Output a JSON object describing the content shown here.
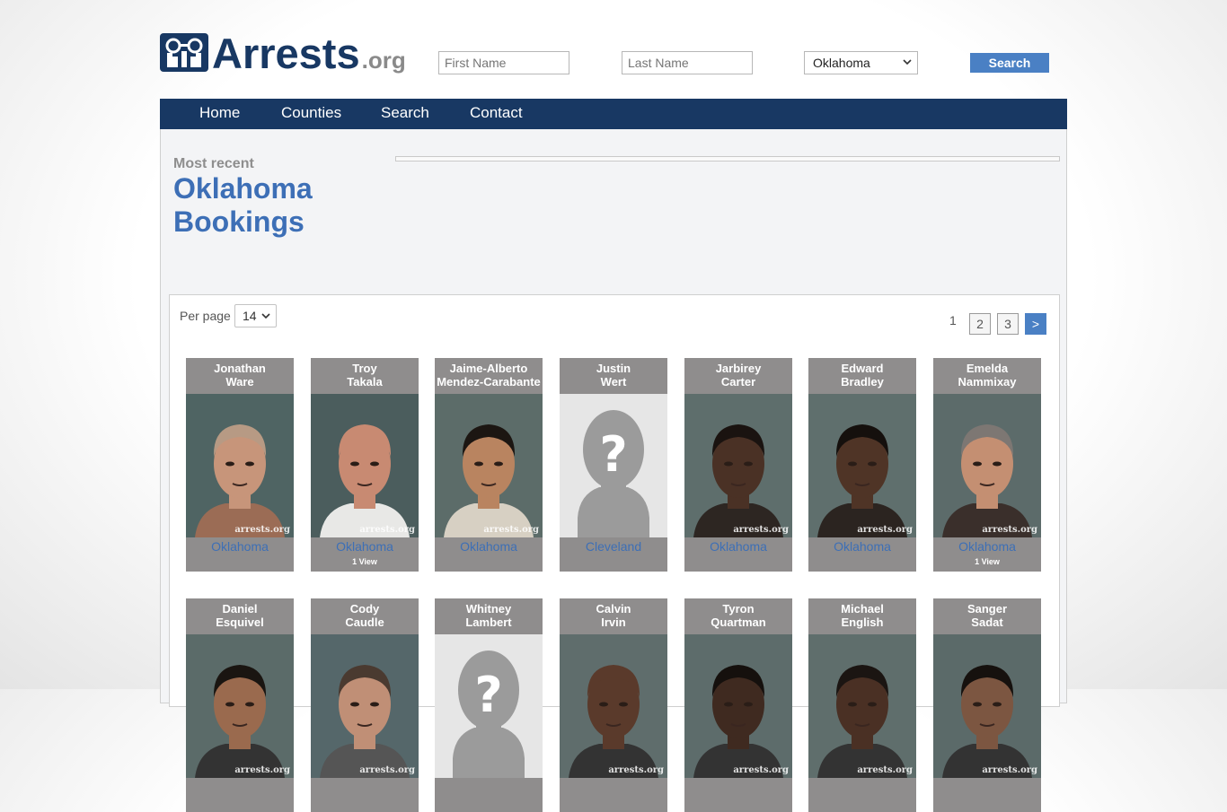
{
  "header": {
    "logo_text": "Arrests",
    "logo_suffix": ".org",
    "first_placeholder": "First Name",
    "last_placeholder": "Last Name",
    "state_selected": "Oklahoma",
    "search_label": "Search"
  },
  "nav": {
    "items": [
      "Home",
      "Counties",
      "Search",
      "Contact"
    ]
  },
  "intro": {
    "eyebrow": "Most recent",
    "title": "Oklahoma Bookings"
  },
  "listing": {
    "per_page_label": "Per page",
    "per_page_value": "14",
    "pages": [
      "1",
      "2",
      "3",
      ">"
    ],
    "watermark": "arrests.org",
    "row1": [
      {
        "first": "Jonathan",
        "last": "Ware",
        "county": "Oklahoma",
        "views": "",
        "skin": "#c7957a",
        "bg": "#4f6463",
        "hair": "#b79a84",
        "shirt": "#9b6c55",
        "placeholder": false
      },
      {
        "first": "Troy",
        "last": "Takala",
        "county": "Oklahoma",
        "views": "1 View",
        "skin": "#c88a72",
        "bg": "#4b5d5d",
        "hair": "#c88a72",
        "shirt": "#e8e8e6",
        "placeholder": false
      },
      {
        "first": "Jaime-Alberto",
        "last": "Mendez-Carabante",
        "county": "Oklahoma",
        "views": "",
        "skin": "#b98460",
        "bg": "#5c6c69",
        "hair": "#1c1612",
        "shirt": "#d7d0c3",
        "placeholder": false
      },
      {
        "first": "Justin",
        "last": "Wert",
        "county": "Cleveland",
        "views": "",
        "skin": "",
        "bg": "",
        "hair": "",
        "shirt": "",
        "placeholder": true
      },
      {
        "first": "Jarbirey",
        "last": "Carter",
        "county": "Oklahoma",
        "views": "",
        "skin": "#4a3125",
        "bg": "#5e6e6c",
        "hair": "#1a1310",
        "shirt": "#2d2622",
        "placeholder": false
      },
      {
        "first": "Edward",
        "last": "Bradley",
        "county": "Oklahoma",
        "views": "",
        "skin": "#4f3426",
        "bg": "#5f6f6d",
        "hair": "#15100d",
        "shirt": "#2b2420",
        "placeholder": false
      },
      {
        "first": "Emelda",
        "last": "Nammixay",
        "county": "Oklahoma",
        "views": "1 View",
        "skin": "#c48f72",
        "bg": "#5c6b6a",
        "hair": "#7d7773",
        "shirt": "#3a2f2b",
        "placeholder": false
      }
    ],
    "row2": [
      {
        "first": "Daniel",
        "last": "Esquivel",
        "county": "",
        "views": "",
        "skin": "#9a6a4e",
        "bg": "#5b6b69",
        "hair": "#1a1511",
        "shirt": "#333",
        "placeholder": false
      },
      {
        "first": "Cody",
        "last": "Caudle",
        "county": "",
        "views": "",
        "skin": "#c08f76",
        "bg": "#55676a",
        "hair": "#4a3a30",
        "shirt": "#555",
        "placeholder": false
      },
      {
        "first": "Whitney",
        "last": "Lambert",
        "county": "",
        "views": "",
        "skin": "",
        "bg": "",
        "hair": "",
        "shirt": "",
        "placeholder": true
      },
      {
        "first": "Calvin",
        "last": "Irvin",
        "county": "",
        "views": "",
        "skin": "#5a3a2b",
        "bg": "#5f6d6c",
        "hair": "#5a3a2b",
        "shirt": "#333",
        "placeholder": false
      },
      {
        "first": "Tyron",
        "last": "Quartman",
        "county": "",
        "views": "",
        "skin": "#3f2a20",
        "bg": "#5d6c6b",
        "hair": "#15100d",
        "shirt": "#333",
        "placeholder": false
      },
      {
        "first": "Michael",
        "last": "English",
        "county": "",
        "views": "",
        "skin": "#4a3024",
        "bg": "#5f6e6c",
        "hair": "#1b1512",
        "shirt": "#333",
        "placeholder": false
      },
      {
        "first": "Sanger",
        "last": "Sadat",
        "county": "",
        "views": "",
        "skin": "#7c5641",
        "bg": "#5b6a69",
        "hair": "#16110e",
        "shirt": "#333",
        "placeholder": false
      }
    ]
  },
  "colors": {
    "navy": "#183863",
    "accent": "#4a80c4",
    "link": "#3d6fb6",
    "card_bg": "#8f8d8d"
  }
}
